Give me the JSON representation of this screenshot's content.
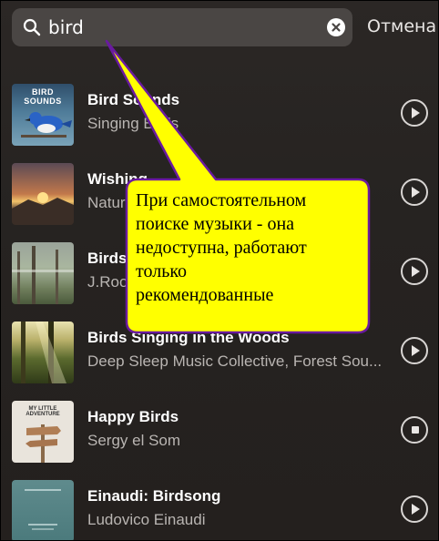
{
  "search": {
    "query": "bird",
    "cancel_label": "Отмена"
  },
  "tracks": [
    {
      "title": "Bird Sounds",
      "artist": "Singing Birds",
      "thumb_text": "BIRD SOUNDS",
      "action": "play"
    },
    {
      "title": "Wishing",
      "artist": "Nature",
      "thumb_text": "",
      "action": "play"
    },
    {
      "title": "Birds",
      "artist": "J.Roo",
      "thumb_text": "",
      "action": "play"
    },
    {
      "title": "Birds Singing in the Woods",
      "artist": "Deep Sleep Music Collective, Forest Sou...",
      "thumb_text": "",
      "action": "play"
    },
    {
      "title": "Happy Birds",
      "artist": "Sergy el Som",
      "thumb_text": "MY LITTLE ADVENTURE",
      "action": "stop"
    },
    {
      "title": "Einaudi: Birdsong",
      "artist": "Ludovico Einaudi",
      "thumb_text": "",
      "action": "play"
    }
  ],
  "annotation": {
    "lines": [
      "При самостоятельном",
      "поиске музыки - она",
      "недоступна, работают",
      "только",
      "рекомендованные"
    ],
    "fill_color": "#ffff00",
    "border_color": "#6a1aa0"
  }
}
